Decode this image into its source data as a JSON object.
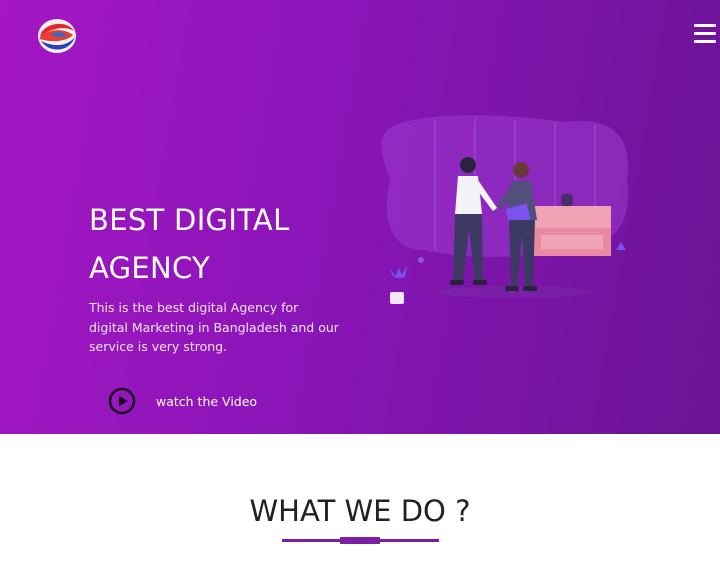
{
  "header": {
    "logo_icon": "brand-logo-icon",
    "menu_icon": "hamburger-menu-icon"
  },
  "hero": {
    "title_line1": "BEST DIGITAL",
    "title_line2": "AGENCY",
    "description": "This is the best digital Agency for digital Marketing in Bangladesh and our service is very strong.",
    "video_label": "watch the Video",
    "play_icon": "play-circle-icon",
    "illustration": "business-handshake-illustration"
  },
  "section": {
    "title": "WHAT WE DO ?"
  },
  "colors": {
    "hero_start": "#a516c4",
    "hero_end": "#6a1494",
    "accent": "#7a1fa2",
    "heading_text": "#222222"
  }
}
